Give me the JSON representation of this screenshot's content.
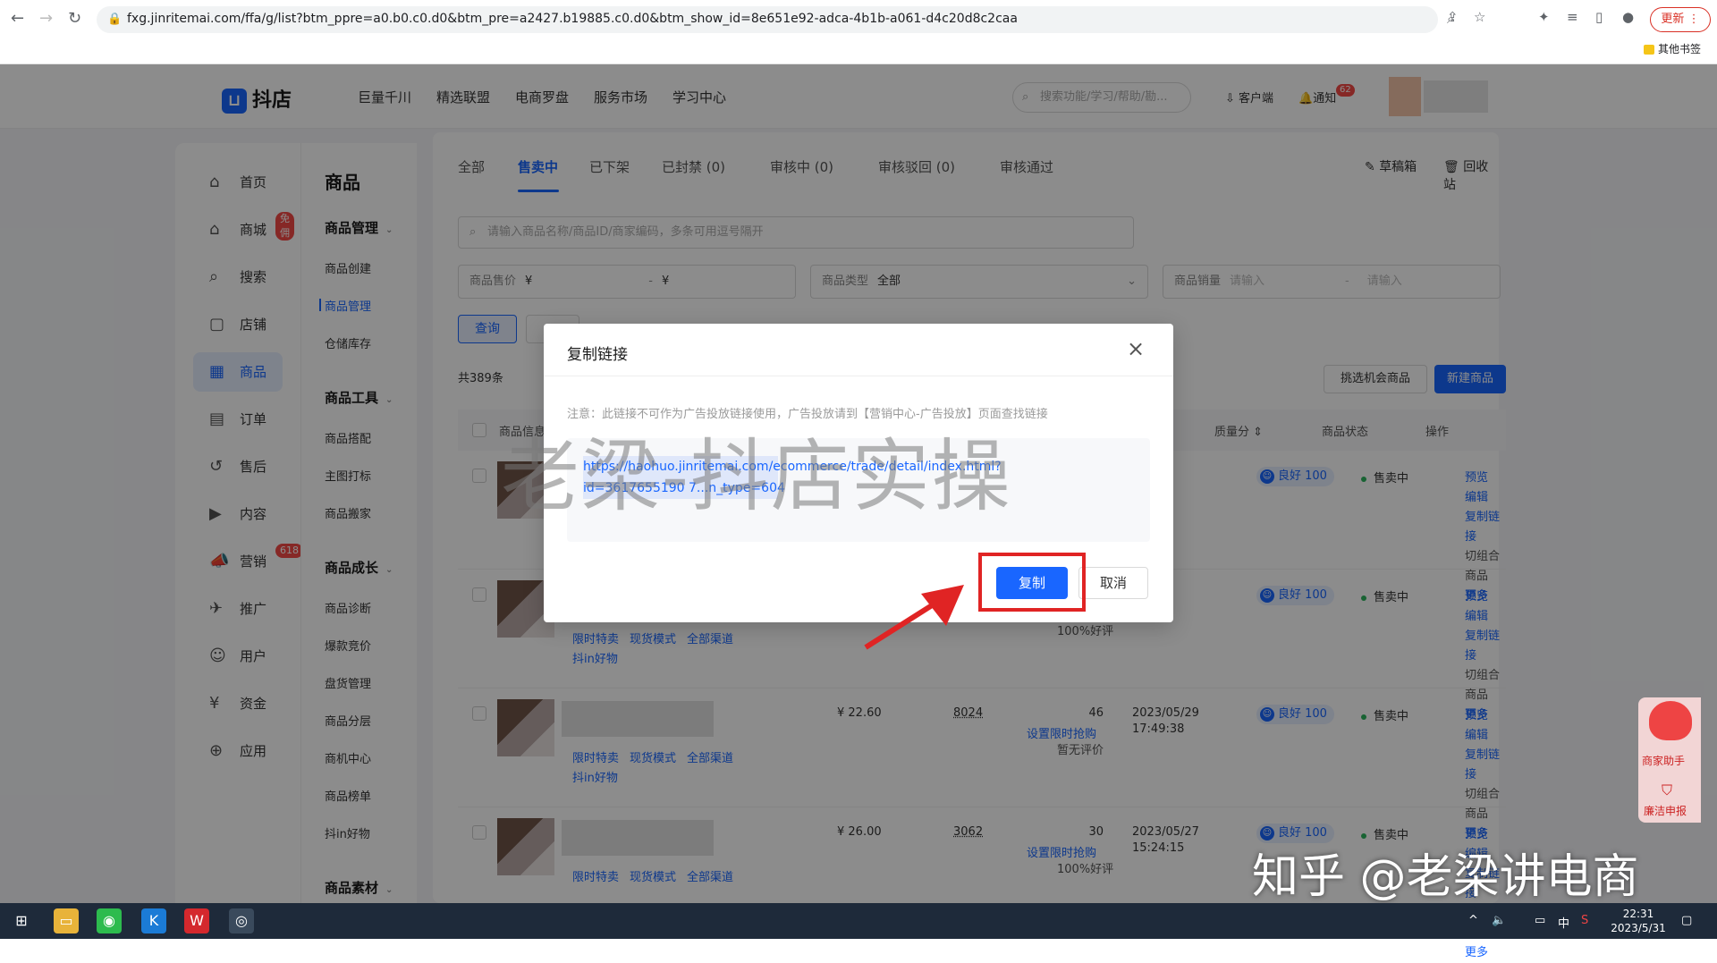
{
  "browser": {
    "url": "fxg.jinritemai.com/ffa/g/list?btm_ppre=a0.b0.c0.d0&btm_pre=a2427.b19885.c0.d0&btm_show_id=8e651e92-adca-4b1b-a061-d4c20d8c2caa",
    "update_label": "更新",
    "bookmarks_label": "其他书签"
  },
  "header": {
    "logo": "抖店",
    "nav": [
      "巨量千川",
      "精选联盟",
      "电商罗盘",
      "服务市场",
      "学习中心"
    ],
    "search_placeholder": "搜索功能/学习/帮助/勘...",
    "client_label": "客户端",
    "notify_label": "通知",
    "notify_count": "62"
  },
  "rail": {
    "items": [
      {
        "label": "首页",
        "icon": "home-icon"
      },
      {
        "label": "商城",
        "icon": "shop-icon",
        "badge": "免佣"
      },
      {
        "label": "搜索",
        "icon": "search-icon"
      },
      {
        "label": "店铺",
        "icon": "store-icon"
      },
      {
        "label": "商品",
        "icon": "goods-icon",
        "active": true
      },
      {
        "label": "订单",
        "icon": "order-icon"
      },
      {
        "label": "售后",
        "icon": "aftersale-icon"
      },
      {
        "label": "内容",
        "icon": "content-icon"
      },
      {
        "label": "营销",
        "icon": "marketing-icon",
        "badge": "618"
      },
      {
        "label": "推广",
        "icon": "promote-icon"
      },
      {
        "label": "用户",
        "icon": "user-icon"
      },
      {
        "label": "资金",
        "icon": "funds-icon"
      },
      {
        "label": "应用",
        "icon": "app-icon"
      }
    ]
  },
  "submenu": {
    "title": "商品",
    "groups": [
      {
        "label": "商品管理",
        "items": [
          "商品创建",
          "商品管理",
          "仓储库存"
        ]
      },
      {
        "label": "商品工具",
        "items": [
          "商品搭配",
          "主图打标",
          "商品搬家"
        ]
      },
      {
        "label": "商品成长",
        "items": [
          "商品诊断",
          "爆款竞价",
          "盘货管理",
          "商品分层",
          "商机中心",
          "商品榜单",
          "抖in好物"
        ]
      },
      {
        "label": "商品素材",
        "items": []
      }
    ],
    "active_item": "商品管理"
  },
  "main": {
    "tabs": [
      "全部",
      "售卖中",
      "已下架",
      "已封禁 (0)",
      "审核中 (0)",
      "审核驳回 (0)",
      "审核通过"
    ],
    "active_tab": "售卖中",
    "draft_label": "草稿箱",
    "recycle_label": "回收站",
    "search_placeholder": "请输入商品名称/商品ID/商家编码，多条可用逗号隔开",
    "filters": {
      "price_label": "商品售价",
      "price_from": "¥",
      "price_sep": "-",
      "price_to": "¥",
      "type_label": "商品类型",
      "type_value": "全部",
      "sales_label": "商品销量",
      "sales_placeholder": "请输入",
      "sales_sep": "-"
    },
    "query_label": "查询",
    "total_label": "共389条",
    "opportunity_label": "挑选机会商品",
    "new_label": "新建商品",
    "columns": [
      "商品信息",
      "质量分",
      "商品状态",
      "操作"
    ],
    "rows": [
      {
        "price": "",
        "stock": "",
        "sold": "",
        "sold_action": "",
        "review": "",
        "date": "",
        "time": "",
        "quality": "良好 100",
        "status": "售卖中",
        "tags": []
      },
      {
        "price": "",
        "stock": "",
        "sold": "",
        "sold_action": "",
        "review": "100%好评",
        "date": "",
        "time": "",
        "quality": "良好 100",
        "status": "售卖中",
        "tags": [
          "限时特卖",
          "现货模式",
          "全部渠道",
          "抖in好物"
        ]
      },
      {
        "price": "¥ 22.60",
        "stock": "8024",
        "sold": "46",
        "sold_action": "设置限时抢购",
        "review": "暂无评价",
        "date": "2023/05/29",
        "time": "17:49:38",
        "quality": "良好 100",
        "status": "售卖中",
        "tags": [
          "限时特卖",
          "现货模式",
          "全部渠道",
          "抖in好物"
        ]
      },
      {
        "price": "¥ 26.00",
        "stock": "3062",
        "sold": "30",
        "sold_action": "设置限时抢购",
        "review": "100%好评",
        "date": "2023/05/27",
        "time": "15:24:15",
        "quality": "良好 100",
        "status": "售卖中",
        "tags": [
          "限时特卖",
          "现货模式",
          "全部渠道"
        ]
      }
    ],
    "ops": [
      "预览",
      "编辑",
      "复制链接",
      "切组合商品",
      "更多"
    ]
  },
  "modal": {
    "title": "复制链接",
    "note": "注意：此链接不可作为广告投放链接使用，广告投放请到【营销中心-广告投放】页面查找链接",
    "link": "https://haohuo.jinritemai.com/ecommerce/trade/detail/index.html?id=3617655190 7...n_type=604",
    "copy_label": "复制",
    "cancel_label": "取消"
  },
  "watermark": "老梁-抖店实操",
  "credit": "知乎 @老梁讲电商",
  "assistant": {
    "title": "商家助手",
    "report": "廉洁申报"
  },
  "taskbar": {
    "time": "22:31",
    "date": "2023/5/31",
    "ime": "中"
  },
  "colors": {
    "primary": "#1966ff",
    "danger": "#e02424",
    "success": "#2db55d"
  }
}
